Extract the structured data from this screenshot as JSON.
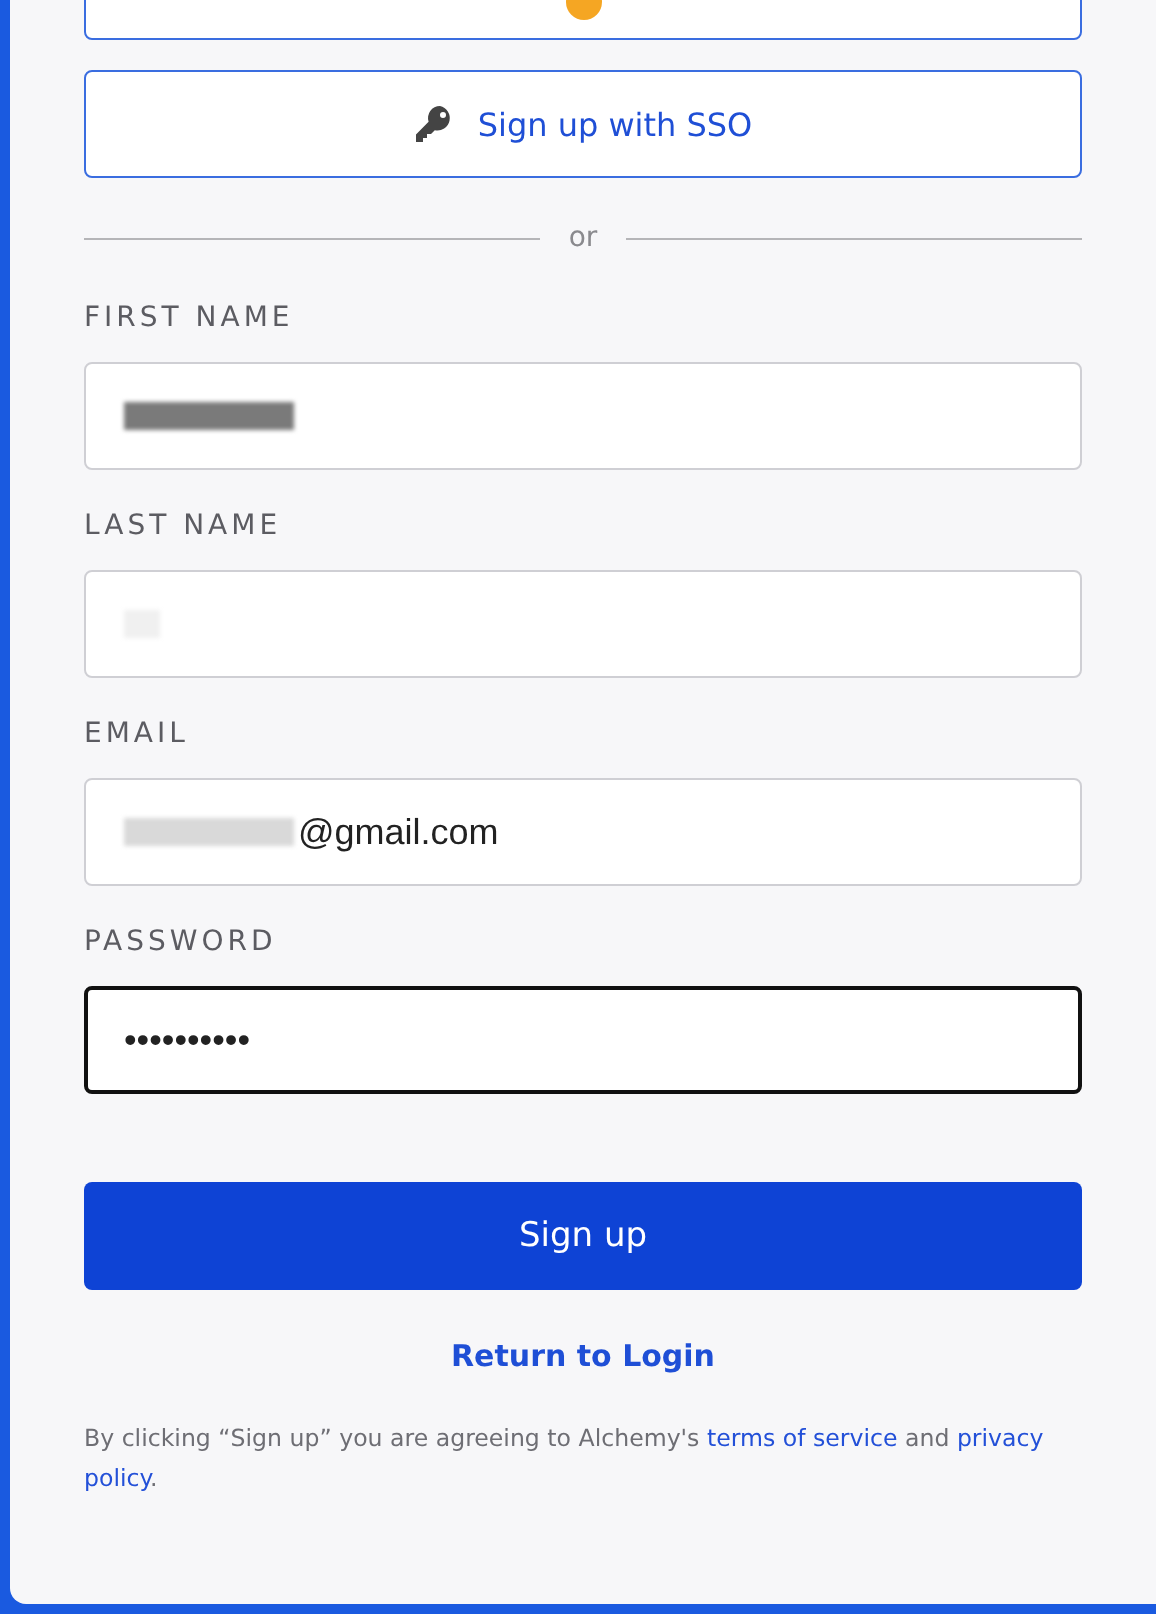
{
  "top_button": {
    "kind": "cut"
  },
  "sso_button": {
    "label": "Sign up with SSO"
  },
  "divider": {
    "label": "or"
  },
  "fields": [
    {
      "label": "FIRST NAME",
      "focused": false
    },
    {
      "label": "LAST NAME",
      "focused": false
    },
    {
      "label": "EMAIL",
      "value": "@gmail.com",
      "focused": false
    },
    {
      "label": "PASSWORD",
      "value": "••••••••••",
      "focused": true
    }
  ],
  "submit_button": {
    "label": "Sign up"
  },
  "login_link": {
    "label": "Return to Login"
  },
  "legal": {
    "text": "By clicking “Sign up” you are agreeing to Alchemy's ",
    "terms": "terms of service",
    "and": " and ",
    "privacy": "privacy policy",
    "end": "."
  }
}
